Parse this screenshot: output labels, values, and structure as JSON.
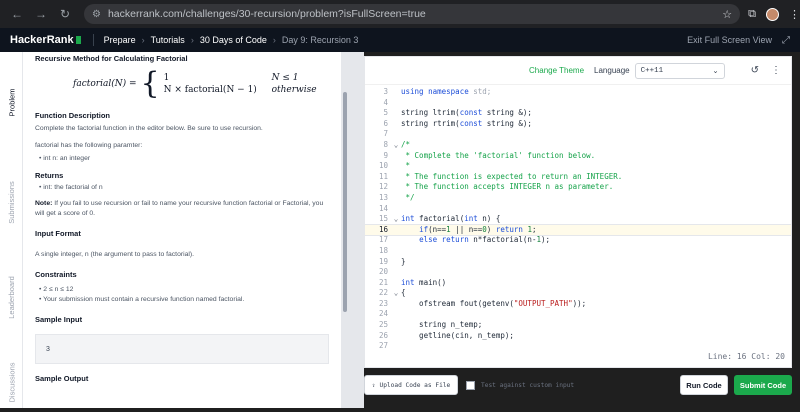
{
  "browser": {
    "url": "hackerrank.com/challenges/30-recursion/problem?isFullScreen=true"
  },
  "header": {
    "logo": "HackerRank",
    "breadcrumbs": [
      "Prepare",
      "Tutorials",
      "30 Days of Code",
      "Day 9: Recursion 3"
    ],
    "exit_label": "Exit Full Screen View"
  },
  "sidetabs": [
    "Problem",
    "Submissions",
    "Leaderboard",
    "Discussions"
  ],
  "problem": {
    "heading": "Recursive Method for Calculating Factorial",
    "formula_lhs": "factorial(N) =",
    "case1_value": "1",
    "case1_cond": "N ≤ 1",
    "case2_value": "N × factorial(N − 1)",
    "case2_cond": "otherwise",
    "fd_heading": "Function Description",
    "fd_text": "Complete the factorial function in the editor below. Be sure to use recursion.",
    "params_intro": "factorial has the following paramter:",
    "param_n": "int n: an integer",
    "returns_heading": "Returns",
    "returns_item": "int: the factorial of n",
    "note_label": "Note:",
    "note_text": " If you fail to use recursion or fail to name your recursive function factorial or Factorial, you will get a score of 0.",
    "input_heading": "Input Format",
    "input_text": "A single integer, n (the argument to pass to factorial).",
    "constraints_heading": "Constraints",
    "constraint1": "2 ≤ n ≤ 12",
    "constraint2": "Your submission must contain a recursive function named factorial.",
    "sample_input_heading": "Sample Input",
    "sample_input_value": "3",
    "sample_output_heading": "Sample Output"
  },
  "editor": {
    "change_theme": "Change Theme",
    "language_label": "Language",
    "language_value": "C++11",
    "status": "Line: 16 Col: 20"
  },
  "footer": {
    "upload": "Upload Code as File",
    "custom_input": "Test against custom input",
    "run": "Run Code",
    "submit": "Submit Code"
  }
}
